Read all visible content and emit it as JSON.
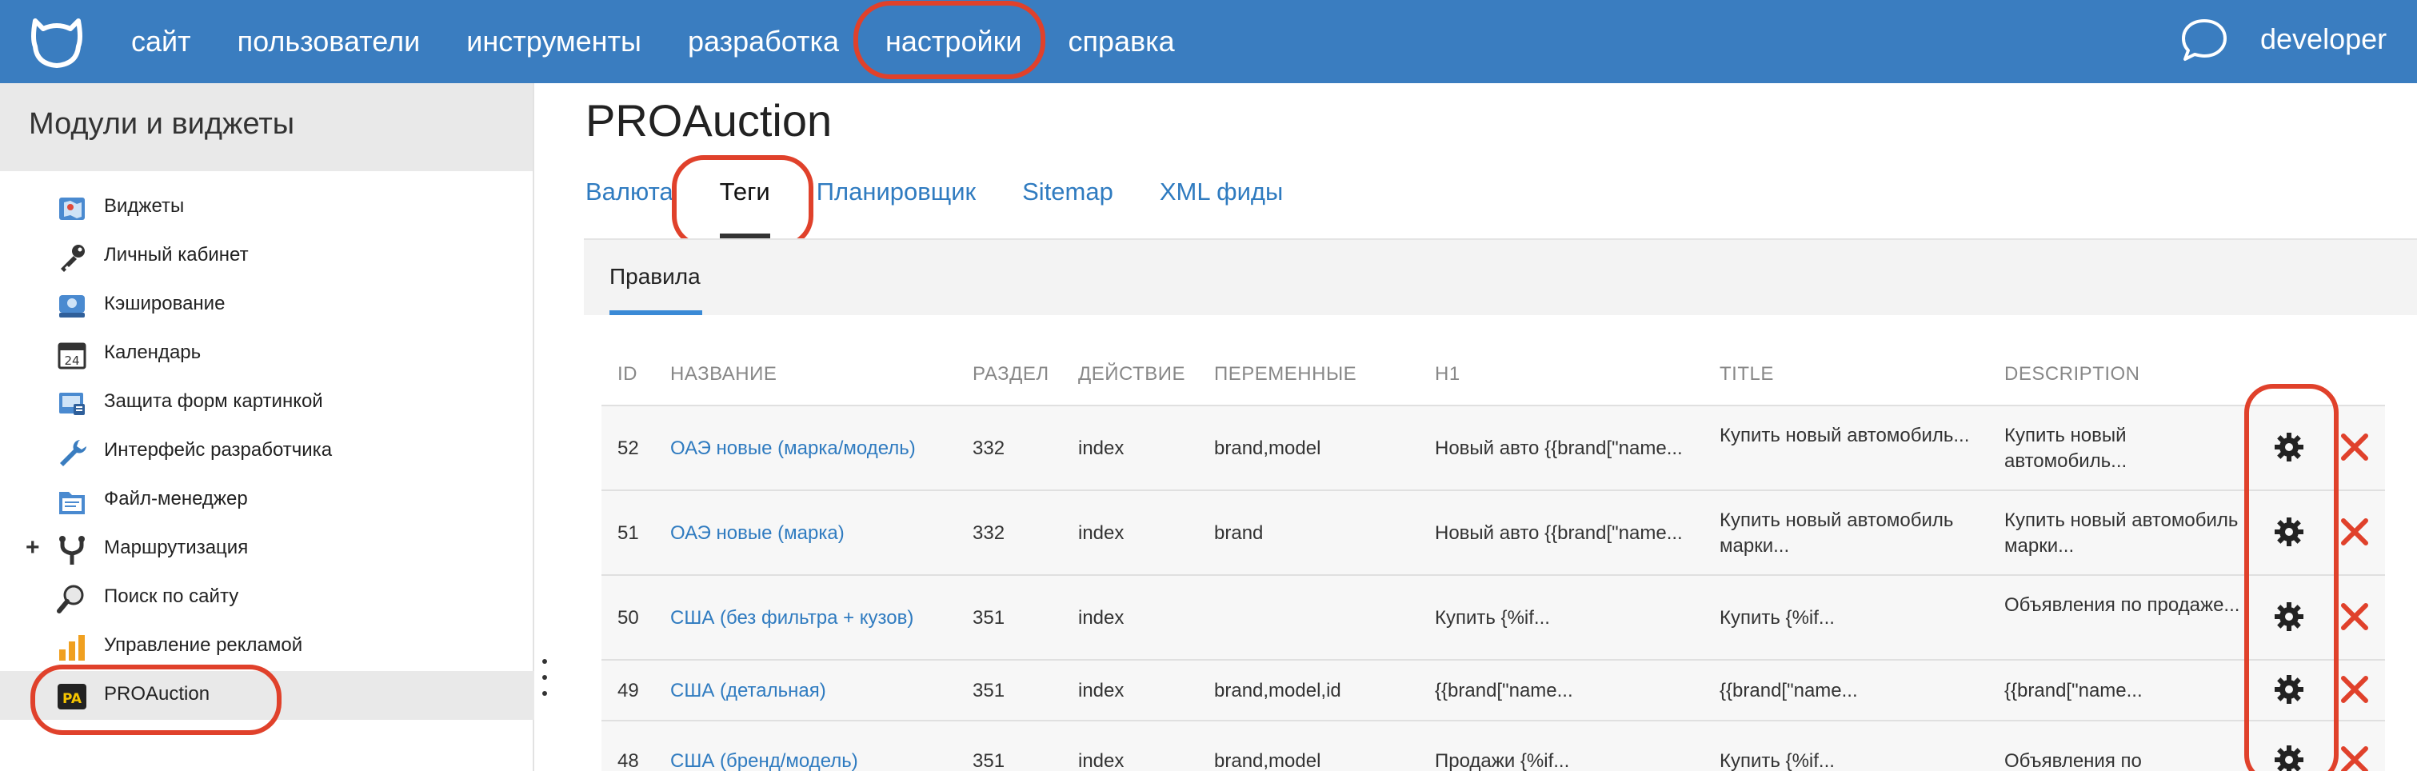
{
  "topbar": {
    "nav": [
      "сайт",
      "пользователи",
      "инструменты",
      "разработка",
      "настройки",
      "справка"
    ],
    "user": "developer"
  },
  "sidebar": {
    "title": "Модули и виджеты",
    "items": [
      {
        "label": "Виджеты",
        "icon": "map-icon"
      },
      {
        "label": "Личный кабинет",
        "icon": "key-icon"
      },
      {
        "label": "Кэширование",
        "icon": "hard-drive-icon"
      },
      {
        "label": "Календарь",
        "icon": "calendar-icon"
      },
      {
        "label": "Защита форм картинкой",
        "icon": "captcha-icon"
      },
      {
        "label": "Интерфейс разработчика",
        "icon": "wrench-icon"
      },
      {
        "label": "Файл-менеджер",
        "icon": "file-manager-icon"
      },
      {
        "label": "Маршрутизация",
        "icon": "routing-icon",
        "expandable": "+"
      },
      {
        "label": "Поиск по сайту",
        "icon": "magnifier-icon"
      },
      {
        "label": "Управление рекламой",
        "icon": "bar-chart-icon"
      },
      {
        "label": "PROAuction",
        "icon": "proauction-icon",
        "icon_text": "PA"
      }
    ]
  },
  "main": {
    "title": "PROAuction",
    "tabs": [
      "Валюта",
      "Теги",
      "Планировщик",
      "Sitemap",
      "XML фиды"
    ],
    "active_tab": "Теги",
    "subtab": "Правила"
  },
  "table": {
    "headers": [
      "ID",
      "НАЗВАНИЕ",
      "РАЗДЕЛ",
      "ДЕЙСТВИЕ",
      "ПЕРЕМЕННЫЕ",
      "H1",
      "TITLE",
      "DESCRIPTION"
    ],
    "rows": [
      {
        "id": "52",
        "name": "ОАЭ новые (марка/модель)",
        "section": "332",
        "action": "index",
        "vars": "brand,model",
        "h1": "Новый авто {{brand[\"name...",
        "title": "Купить новый автомобиль...",
        "description": "Купить новый автомобиль..."
      },
      {
        "id": "51",
        "name": "ОАЭ новые (марка)",
        "section": "332",
        "action": "index",
        "vars": "brand",
        "h1": "Новый авто {{brand[\"name...",
        "title": "Купить новый автомобиль марки...",
        "description": "Купить новый автомобиль марки..."
      },
      {
        "id": "50",
        "name": "США (без фильтра + кузов)",
        "section": "351",
        "action": "index",
        "vars": "",
        "h1": "Купить {%if...",
        "title": "Купить {%if...",
        "description": "Объявления по продаже..."
      },
      {
        "id": "49",
        "name": "США (детальная)",
        "section": "351",
        "action": "index",
        "vars": "brand,model,id",
        "h1": "{{brand[\"name...",
        "title": "{{brand[\"name...",
        "description": "{{brand[\"name..."
      },
      {
        "id": "48",
        "name": "США (бренд/модель)",
        "section": "351",
        "action": "index",
        "vars": "brand,model",
        "h1": "Продажи {%if...",
        "title": "Купить {%if...",
        "description": "Объявления по"
      }
    ]
  },
  "colors": {
    "topbar": "#3a7dc0",
    "link": "#2f7bc0",
    "highlight": "#e0412b",
    "delete": "#e0412b"
  }
}
